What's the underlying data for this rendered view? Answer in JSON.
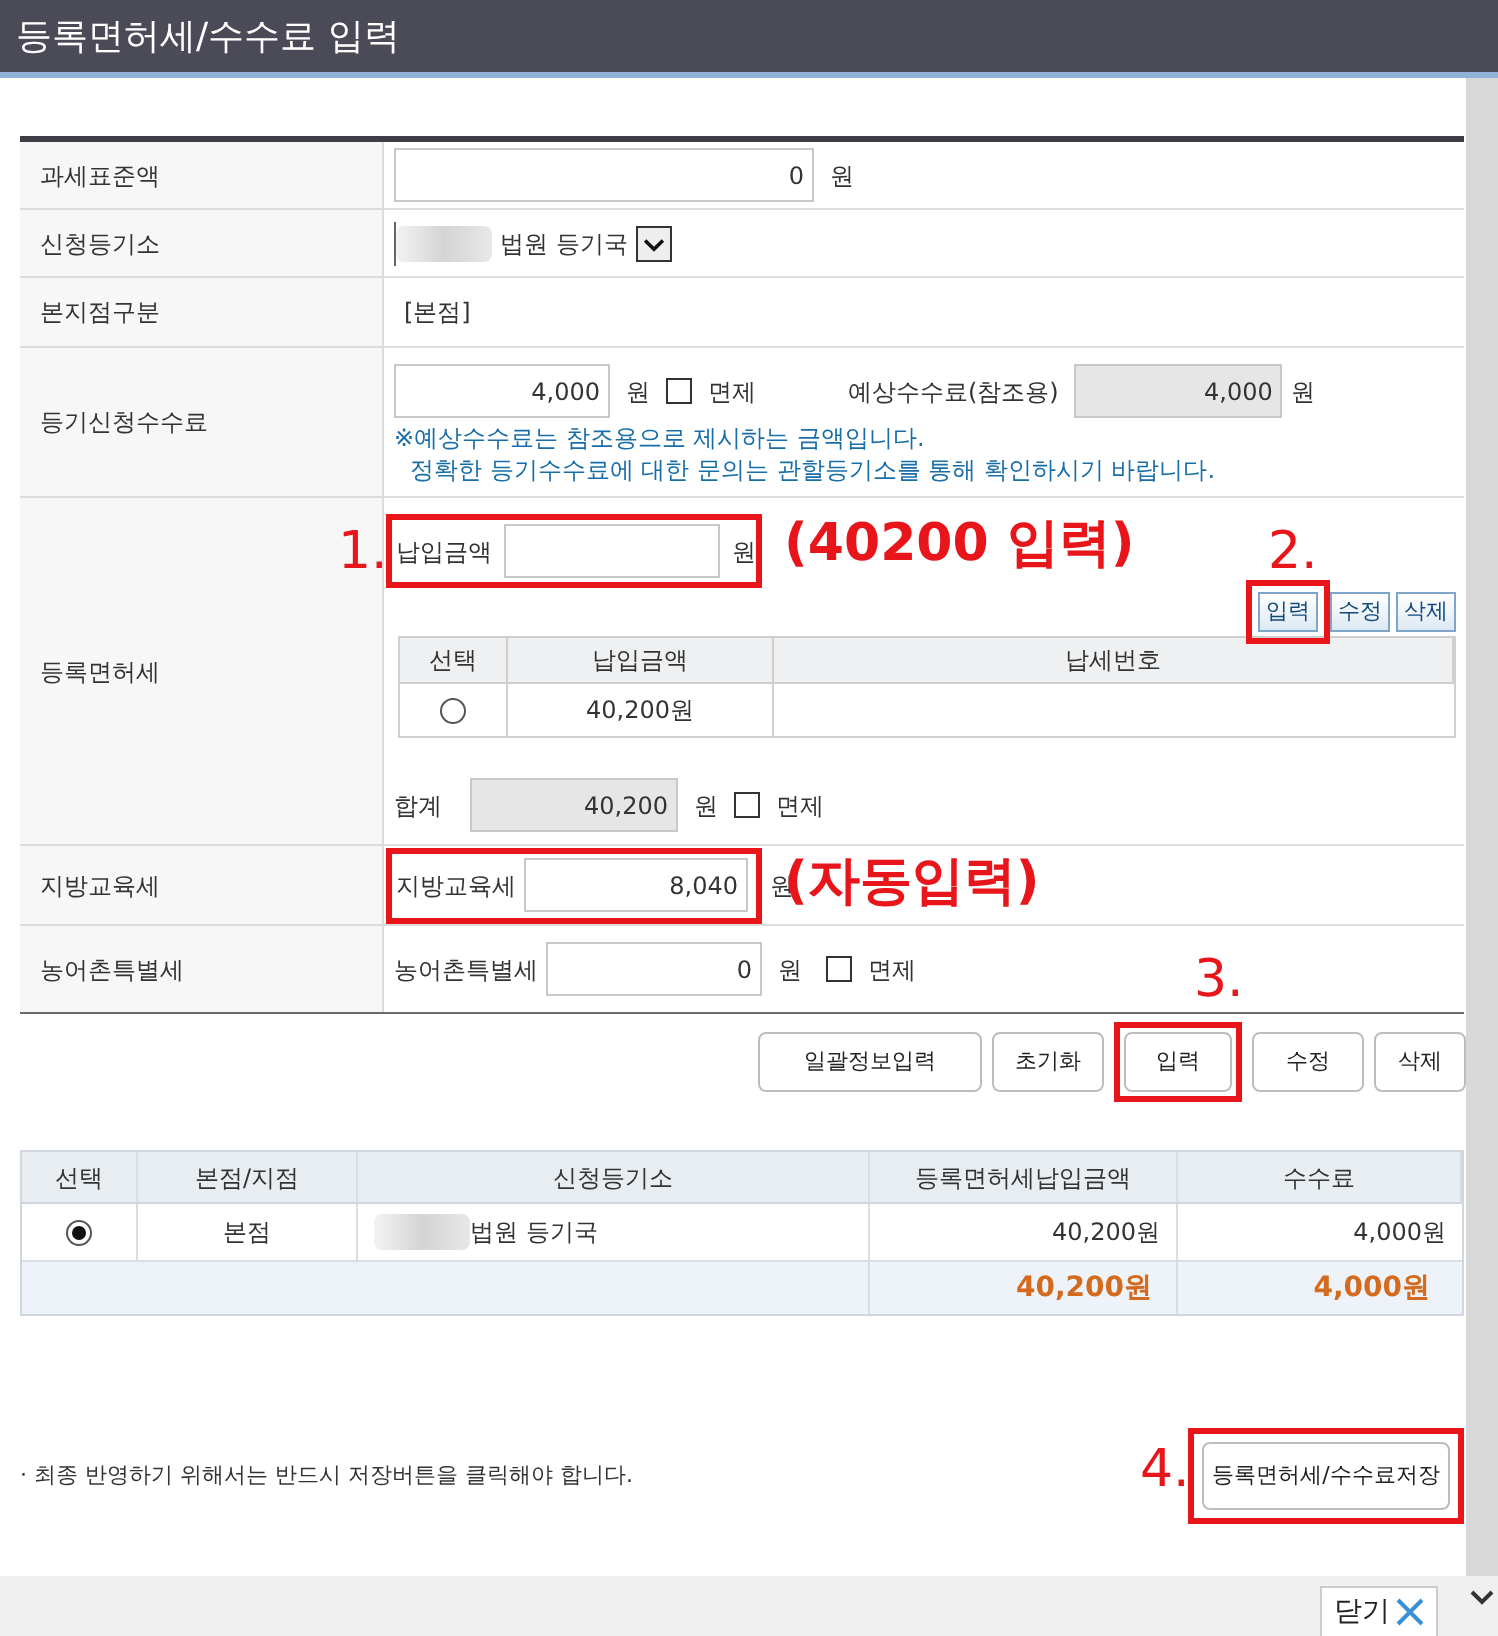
{
  "window": {
    "title": "등록면허세/수수료 입력"
  },
  "tax_base": {
    "label": "과세표준액",
    "value": "0",
    "unit": "원"
  },
  "registry_office": {
    "label": "신청등기소",
    "value": "법원 등기국"
  },
  "branch_type": {
    "label": "본지점구분",
    "value": "[본점]"
  },
  "application_fee": {
    "label": "등기신청수수료",
    "value": "4,000",
    "unit": "원",
    "exempt": {
      "label": "면제",
      "checked": false
    },
    "estimate_label": "예상수수료(참조용)",
    "estimate_value": "4,000",
    "estimate_unit": "원",
    "notes": [
      "※예상수수료는 참조용으로 제시하는 금액입니다.",
      "정확한 등기수수료에 대한 문의는 관할등기소를 통해 확인하시기 바랍니다."
    ]
  },
  "registration_tax": {
    "label": "등록면허세",
    "amount_label": "납입금액",
    "unit": "원",
    "buttons": [
      "입력",
      "수정",
      "삭제"
    ],
    "columns": [
      "선택",
      "납입금액",
      "납세번호"
    ],
    "rows": [
      {
        "selected": false,
        "amount": "40,200원"
      }
    ],
    "total_label": "합계",
    "total_value": "40,200",
    "total_unit": "원",
    "exempt": {
      "label": "면제",
      "checked": false
    }
  },
  "education_tax": {
    "label": "지방교육세",
    "field_label": "지방교육세",
    "value": "8,040",
    "unit": "원"
  },
  "rural_tax": {
    "label": "농어촌특별세",
    "field_label": "농어촌특별세",
    "value": "0",
    "unit": "원",
    "exempt": {
      "label": "면제",
      "checked": false
    }
  },
  "actions": [
    "일괄정보입력",
    "초기화",
    "입력",
    "수정",
    "삭제"
  ],
  "summary_table": {
    "columns": [
      "선택",
      "본점/지점",
      "신청등기소",
      "등록면허세납입금액",
      "수수료"
    ],
    "rows": [
      {
        "selected": true,
        "branch": "본점",
        "office": "법원 등기국",
        "tax": "40,200원",
        "fee": "4,000원"
      }
    ],
    "totals": {
      "tax": "40,200원",
      "fee": "4,000원"
    }
  },
  "notice": "· 최종 반영하기 위해서는 반드시 저장버튼을 클릭해야 합니다.",
  "save_button": "등록면허세/수수료저장",
  "close_button": "닫기",
  "annotations": {
    "markers": [
      "1.",
      "2.",
      "3.",
      "4."
    ],
    "notes": [
      "(40200 입력)",
      "(자동입력)"
    ]
  }
}
